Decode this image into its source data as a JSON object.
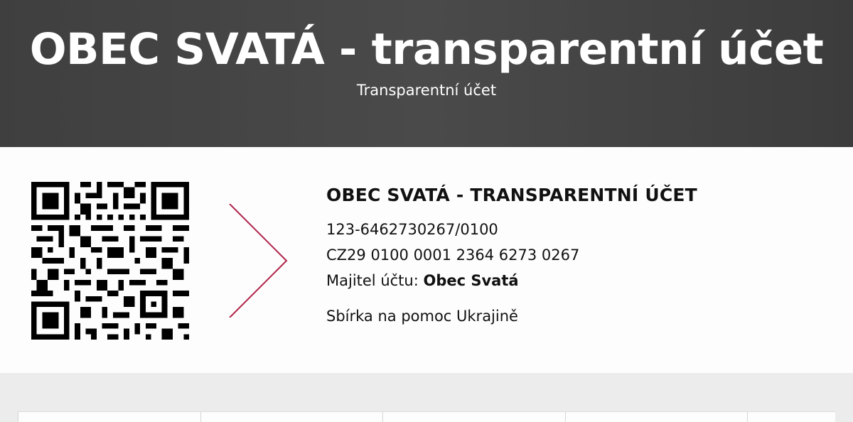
{
  "header": {
    "title": "OBEC SVATÁ - transparentní účet",
    "subtitle": "Transparentní účet"
  },
  "account": {
    "title": "OBEC SVATÁ - TRANSPARENTNÍ ÚČET",
    "number": "123-6462730267/0100",
    "iban": "CZ29 0100 0001 2364 6273 0267",
    "owner_label": "Majitel účtu:",
    "owner_name": "Obec Svatá",
    "note": "Sbírka na pomoc Ukrajině"
  },
  "colors": {
    "header_bg": "#444444",
    "arrow": "#b0224a",
    "card_bg": "#fdfdfd",
    "page_bg": "#ececec"
  },
  "icons": {
    "qr": "qr-code",
    "arrow": "chevron-right-icon"
  }
}
